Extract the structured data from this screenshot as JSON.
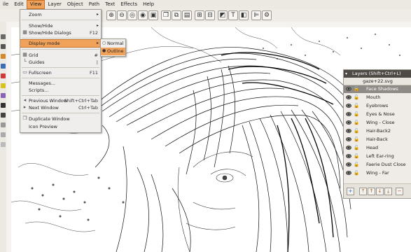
{
  "menubar": {
    "items": [
      "ile",
      "Edit",
      "View",
      "Layer",
      "Object",
      "Path",
      "Text",
      "Effects",
      "Help"
    ]
  },
  "view_menu": {
    "items": [
      {
        "label": "Zoom",
        "shortcut": "",
        "submenu": true
      },
      {
        "label": "Show/Hide",
        "shortcut": "",
        "submenu": true
      },
      {
        "label": "Show/Hide Dialogs",
        "shortcut": "F12",
        "submenu": false
      },
      {
        "label": "Display mode",
        "shortcut": "",
        "submenu": true,
        "highlighted": true
      },
      {
        "label": "Grid",
        "shortcut": "#",
        "submenu": false
      },
      {
        "label": "Guides",
        "shortcut": "|",
        "submenu": false
      },
      {
        "label": "Fullscreen",
        "shortcut": "F11",
        "submenu": false
      },
      {
        "label": "Messages...",
        "shortcut": "",
        "submenu": false
      },
      {
        "label": "Scripts...",
        "shortcut": "",
        "submenu": false
      },
      {
        "label": "Previous Window",
        "shortcut": "Shift+Ctrl+Tab",
        "submenu": false
      },
      {
        "label": "Next Window",
        "shortcut": "Ctrl+Tab",
        "submenu": false
      },
      {
        "label": "Duplicate Window",
        "shortcut": "",
        "submenu": false
      },
      {
        "label": "Icon Preview",
        "shortcut": "",
        "submenu": false
      }
    ]
  },
  "display_mode_submenu": {
    "items": [
      {
        "label": "Normal",
        "selected": false
      },
      {
        "label": "Outline",
        "selected": true
      }
    ]
  },
  "layers_panel": {
    "title": "Layers (Shift+Ctrl+L)",
    "file": "gaze+22.svg",
    "layers": [
      {
        "label": "Face Shadows",
        "selected": true
      },
      {
        "label": "Mouth",
        "selected": false
      },
      {
        "label": "Eyebrows",
        "selected": false
      },
      {
        "label": "Eyes & Nose",
        "selected": false
      },
      {
        "label": "Wing - Close",
        "selected": false
      },
      {
        "label": "Hair-Back2",
        "selected": false
      },
      {
        "label": "Hair-Back",
        "selected": false
      },
      {
        "label": "Head",
        "selected": false
      },
      {
        "label": "Left Ear-ring",
        "selected": false
      },
      {
        "label": "Faerie Dust Close",
        "selected": false
      },
      {
        "label": "Wing - Far",
        "selected": false
      }
    ]
  },
  "colors": {
    "highlight": "#f0a25a",
    "menubar_bg": "#ece8e2",
    "panel_title_bg": "#4e4b47",
    "selected_layer_bg": "#8e8a85"
  }
}
